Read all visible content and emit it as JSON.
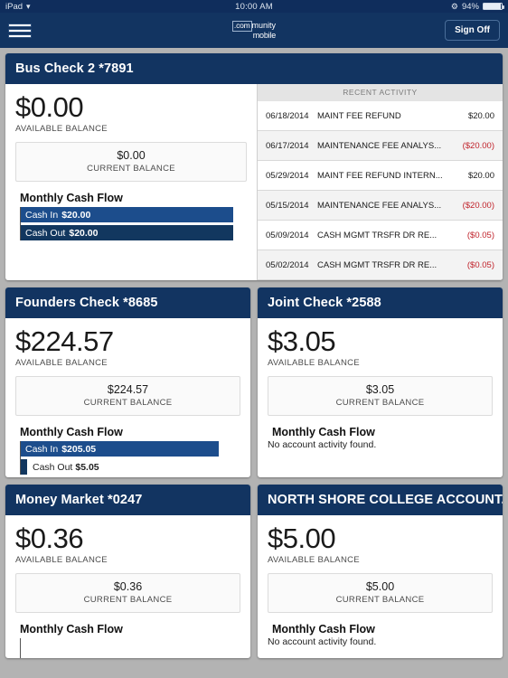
{
  "status_bar": {
    "device": "iPad",
    "wifi_icon": "wifi-icon",
    "time": "10:00 AM",
    "bluetooth_icon": "bluetooth-icon",
    "battery_percent": "94%"
  },
  "navbar": {
    "menu_icon": "hamburger-menu-icon",
    "logo_com": ".com",
    "logo_munity": "munity",
    "logo_mobile": "mobile",
    "sign_off_label": "Sign Off"
  },
  "labels": {
    "available_balance": "AVAILABLE BALANCE",
    "current_balance": "CURRENT BALANCE",
    "monthly_cash_flow": "Monthly Cash Flow",
    "no_activity": "No account activity found.",
    "recent_activity": "RECENT ACTIVITY",
    "cash_in": "Cash In",
    "cash_out": "Cash Out"
  },
  "colors": {
    "navy": "#123461",
    "bar_in": "#1c4d8c",
    "bar_out": "#12375f",
    "negative": "#c0222a",
    "page_bg": "#b3b3b3"
  },
  "accounts": [
    {
      "title": "Bus Check 2 *7891",
      "available": "$0.00",
      "current": "$0.00",
      "has_activity": true,
      "cash_in_amount": "$20.00",
      "cash_out_amount": "$20.00",
      "cash_in_pct": 100,
      "cash_out_pct": 100,
      "transactions": [
        {
          "date": "06/18/2014",
          "description": "MAINT FEE REFUND",
          "amount": "$20.00",
          "negative": false
        },
        {
          "date": "06/17/2014",
          "description": "MAINTENANCE FEE ANALYS...",
          "amount": "($20.00)",
          "negative": true
        },
        {
          "date": "05/29/2014",
          "description": "MAINT FEE REFUND INTERN...",
          "amount": "$20.00",
          "negative": false
        },
        {
          "date": "05/15/2014",
          "description": "MAINTENANCE FEE ANALYS...",
          "amount": "($20.00)",
          "negative": true
        },
        {
          "date": "05/09/2014",
          "description": "CASH MGMT TRSFR DR RE...",
          "amount": "($0.05)",
          "negative": true
        },
        {
          "date": "05/02/2014",
          "description": "CASH MGMT TRSFR DR RE...",
          "amount": "($0.05)",
          "negative": true
        }
      ]
    },
    {
      "title": "Founders Check *8685",
      "available": "$224.57",
      "current": "$224.57",
      "has_activity": true,
      "cash_in_amount": "$205.05",
      "cash_out_amount": "$5.05",
      "cash_in_pct": 100,
      "cash_out_pct": 3
    },
    {
      "title": "Joint Check *2588",
      "available": "$3.05",
      "current": "$3.05",
      "has_activity": false
    },
    {
      "title": "Money Market *0247",
      "available": "$0.36",
      "current": "$0.36",
      "has_activity": true
    },
    {
      "title": "NORTH SHORE COLLEGE ACCOUNT...",
      "available": "$5.00",
      "current": "$5.00",
      "has_activity": false
    }
  ],
  "chart_data": [
    {
      "type": "bar",
      "title": "Monthly Cash Flow",
      "account": "Bus Check 2 *7891",
      "categories": [
        "Cash In",
        "Cash Out"
      ],
      "values": [
        20.0,
        20.0
      ],
      "xlabel": "",
      "ylabel": "",
      "xlim": [
        0,
        20
      ],
      "grid": false,
      "legend": false,
      "orientation": "horizontal"
    },
    {
      "type": "bar",
      "title": "Monthly Cash Flow",
      "account": "Founders Check *8685",
      "categories": [
        "Cash In",
        "Cash Out"
      ],
      "values": [
        205.05,
        5.05
      ],
      "xlabel": "",
      "ylabel": "",
      "xlim": [
        0,
        205.05
      ],
      "grid": false,
      "legend": false,
      "orientation": "horizontal"
    }
  ]
}
